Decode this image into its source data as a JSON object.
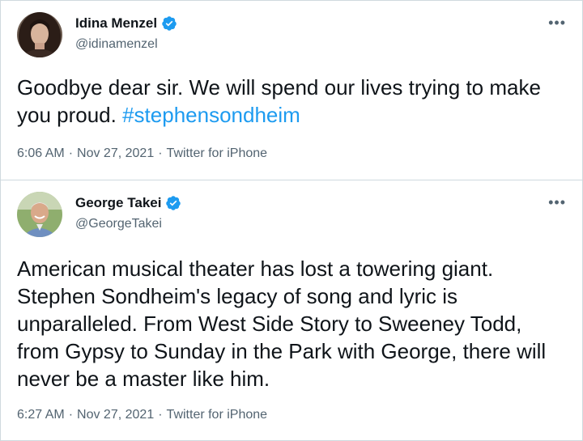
{
  "tweets": [
    {
      "display_name": "Idina Menzel",
      "handle": "@idinamenzel",
      "text_pre": "Goodbye dear sir. We will spend our lives trying to make you proud. ",
      "hashtag": "#stephensondheim",
      "time": "6:06 AM",
      "date": "Nov 27, 2021",
      "source": "Twitter for iPhone",
      "more_icon": "more-horizontal-icon",
      "verified_icon": "verified-badge-icon"
    },
    {
      "display_name": "George Takei",
      "handle": "@GeorgeTakei",
      "text": "American musical theater has lost a towering giant. Stephen Sondheim's legacy of song and lyric is unparalleled. From West Side Story to Sweeney Todd, from Gypsy to Sunday in the Park with George, there will never be a master like him.",
      "time": "6:27 AM",
      "date": "Nov 27, 2021",
      "source": "Twitter for iPhone",
      "more_icon": "more-horizontal-icon",
      "verified_icon": "verified-badge-icon"
    }
  ],
  "separator": "·",
  "more_glyph": "•••",
  "colors": {
    "link": "#1d9bf0",
    "secondary_text": "#536471",
    "primary_text": "#0f1419",
    "verified": "#1d9bf0",
    "border": "#cfd9de"
  }
}
